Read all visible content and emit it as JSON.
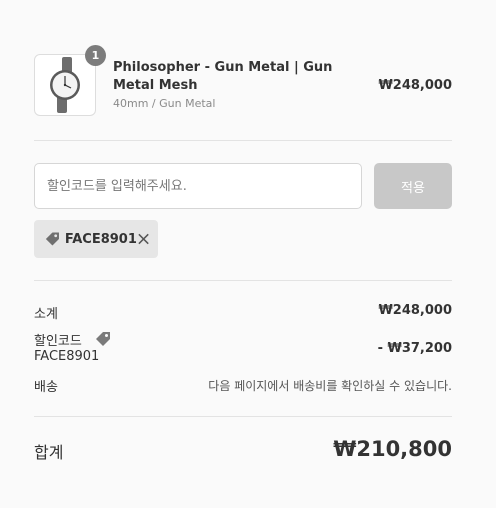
{
  "product": {
    "quantity": "1",
    "name": "Philosopher - Gun Metal | Gun Metal Mesh",
    "variant": "40mm / Gun Metal",
    "price": "₩248,000",
    "image_icon": "watch-icon"
  },
  "discount": {
    "placeholder": "할인코드를 입력해주세요.",
    "value": "",
    "apply_label": "적용",
    "applied_code": "FACE8901",
    "tag_icon": "tag-icon",
    "remove_icon": "close-icon"
  },
  "summary": {
    "subtotal_label": "소계",
    "subtotal_value": "₩248,000",
    "discount_label": "할인코드",
    "discount_code": "FACE8901",
    "discount_value": "- ₩37,200",
    "shipping_label": "배송",
    "shipping_note": "다음 페이지에서 배송비를 확인하실 수 있습니다."
  },
  "total": {
    "label": "합계",
    "value": "₩210,800"
  },
  "colors": {
    "text": "#333333",
    "muted": "#8a8a8a",
    "badge": "#7c7c7c",
    "apply_button": "#c8c8c8",
    "chip": "#e6e6e6",
    "divider": "#e3e3e3"
  }
}
